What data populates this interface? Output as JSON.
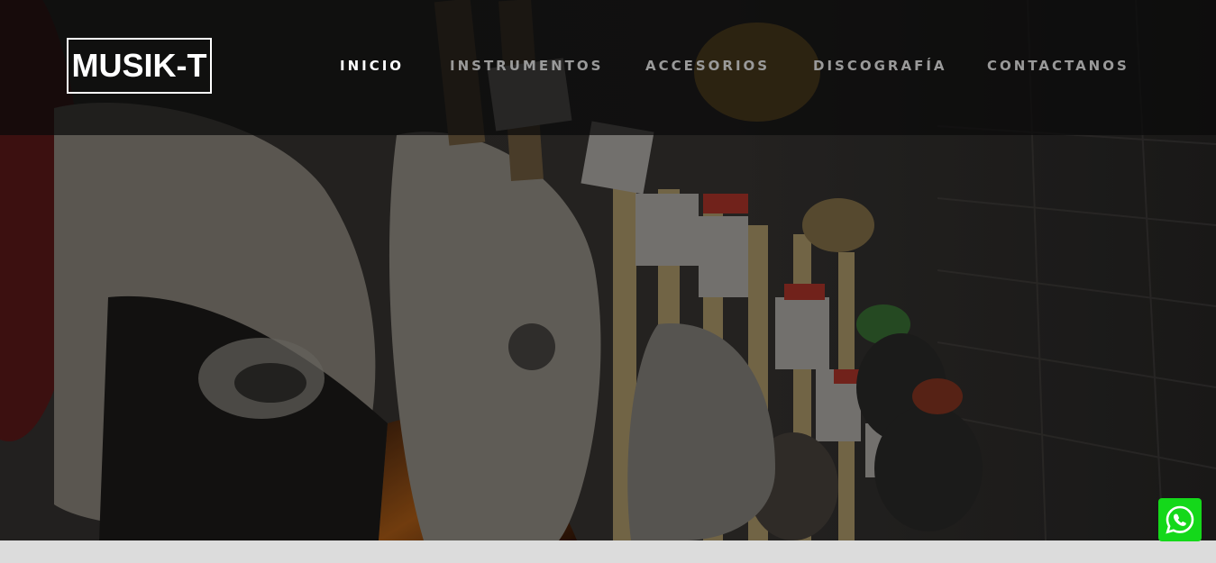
{
  "brand": {
    "logo_text": "MUSIK-T"
  },
  "nav": {
    "items": [
      {
        "label": "INICIO",
        "active": true
      },
      {
        "label": "INSTRUMENTOS",
        "active": false
      },
      {
        "label": "ACCESORIOS",
        "active": false
      },
      {
        "label": "DISCOGRAFÍA",
        "active": false
      },
      {
        "label": "CONTACTANOS",
        "active": false
      }
    ]
  },
  "hero": {
    "background": "guitar-wall-photo"
  },
  "floating": {
    "whatsapp_icon": "whatsapp-icon"
  },
  "colors": {
    "nav_active": "#ffffff",
    "nav_inactive": "#9a9a9a",
    "whatsapp": "#14d81a",
    "bottom_strip": "#dcdcdc"
  }
}
